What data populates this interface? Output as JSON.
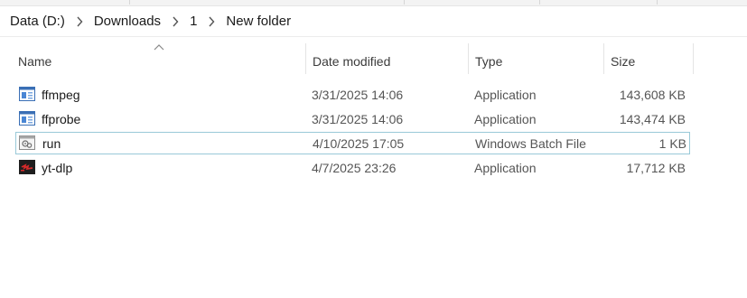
{
  "breadcrumb": {
    "items": [
      {
        "label": "Data (D:)"
      },
      {
        "label": "Downloads"
      },
      {
        "label": "1"
      },
      {
        "label": "New folder"
      }
    ]
  },
  "columns": {
    "name": "Name",
    "date": "Date modified",
    "type": "Type",
    "size": "Size",
    "sort_column": "name",
    "sort_direction": "ascending"
  },
  "files": [
    {
      "name": "ffmpeg",
      "date": "3/31/2025 14:06",
      "type": "Application",
      "size": "143,608 KB",
      "icon": "application-icon"
    },
    {
      "name": "ffprobe",
      "date": "3/31/2025 14:06",
      "type": "Application",
      "size": "143,474 KB",
      "icon": "application-icon"
    },
    {
      "name": "run",
      "date": "4/10/2025 17:05",
      "type": "Windows Batch File",
      "size": "1 KB",
      "icon": "batch-file-icon",
      "focused": true
    },
    {
      "name": "yt-dlp",
      "date": "4/7/2025 23:26",
      "type": "Application",
      "size": "17,712 KB",
      "icon": "yt-dlp-app-icon"
    }
  ],
  "colors": {
    "focus_border": "#99c9d8",
    "accent_blue": "#2f6fd6"
  }
}
